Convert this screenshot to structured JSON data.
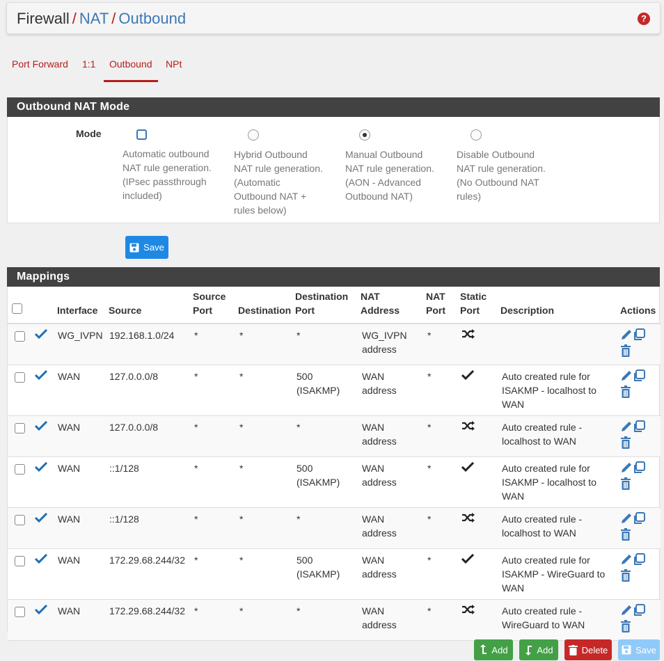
{
  "breadcrumb": {
    "part1": "Firewall",
    "sep1": "/",
    "part2": "NAT",
    "sep2": "/",
    "part3": "Outbound",
    "help_icon": "question-circle-icon"
  },
  "tabs": [
    {
      "label": "Port Forward",
      "active": false
    },
    {
      "label": "1:1",
      "active": false
    },
    {
      "label": "Outbound",
      "active": true
    },
    {
      "label": "NPt",
      "active": false
    }
  ],
  "mode_panel": {
    "title": "Outbound NAT Mode",
    "label": "Mode",
    "options": [
      {
        "text": [
          "Automatic outbound",
          "NAT rule generation.",
          "(IPsec passthrough",
          "included)"
        ],
        "selected": false
      },
      {
        "text": [
          "Hybrid Outbound",
          "NAT rule generation.",
          "(Automatic",
          "Outbound NAT +",
          "rules below)"
        ],
        "selected": false
      },
      {
        "text": [
          "Manual Outbound",
          "NAT rule generation.",
          "(AON - Advanced",
          "Outbound NAT)"
        ],
        "selected": true
      },
      {
        "text": [
          "Disable Outbound",
          "NAT rule generation.",
          "(No Outbound NAT",
          "rules)"
        ],
        "selected": false
      }
    ],
    "save_label": "Save"
  },
  "mappings": {
    "title": "Mappings",
    "headers": {
      "interface": "Interface",
      "source": "Source",
      "source_port": [
        "Source",
        "Port"
      ],
      "destination": "Destination",
      "destination_port": [
        "Destination",
        "Port"
      ],
      "nat_address": "NAT Address",
      "nat_port": [
        "NAT",
        "Port"
      ],
      "static_port": [
        "Static",
        "Port"
      ],
      "description": "Description",
      "actions": "Actions"
    },
    "rows": [
      {
        "interface": "WG_IVPN",
        "source": "192.168.1.0/24",
        "source_port": "*",
        "destination": "*",
        "destination_port": [
          "*"
        ],
        "nat_address": [
          "WG_IVPN",
          "address"
        ],
        "nat_port": "*",
        "static": "shuffle",
        "description": []
      },
      {
        "interface": "WAN",
        "source": "127.0.0.0/8",
        "source_port": "*",
        "destination": "*",
        "destination_port": [
          "500",
          "(ISAKMP)"
        ],
        "nat_address": [
          "WAN",
          "address"
        ],
        "nat_port": "*",
        "static": "check",
        "description": [
          "Auto created rule for",
          "ISAKMP - localhost to",
          "WAN"
        ]
      },
      {
        "interface": "WAN",
        "source": "127.0.0.0/8",
        "source_port": "*",
        "destination": "*",
        "destination_port": [
          "*"
        ],
        "nat_address": [
          "WAN",
          "address"
        ],
        "nat_port": "*",
        "static": "shuffle",
        "description": [
          "Auto created rule -",
          "localhost to WAN"
        ]
      },
      {
        "interface": "WAN",
        "source": "::1/128",
        "source_port": "*",
        "destination": "*",
        "destination_port": [
          "500",
          "(ISAKMP)"
        ],
        "nat_address": [
          "WAN",
          "address"
        ],
        "nat_port": "*",
        "static": "check",
        "description": [
          "Auto created rule for",
          "ISAKMP - localhost to",
          "WAN"
        ]
      },
      {
        "interface": "WAN",
        "source": "::1/128",
        "source_port": "*",
        "destination": "*",
        "destination_port": [
          "*"
        ],
        "nat_address": [
          "WAN",
          "address"
        ],
        "nat_port": "*",
        "static": "shuffle",
        "description": [
          "Auto created rule -",
          "localhost to WAN"
        ]
      },
      {
        "interface": "WAN",
        "source": "172.29.68.244/32",
        "source_port": "*",
        "destination": "*",
        "destination_port": [
          "500",
          "(ISAKMP)"
        ],
        "nat_address": [
          "WAN",
          "address"
        ],
        "nat_port": "*",
        "static": "check",
        "description": [
          "Auto created rule for",
          "ISAKMP - WireGuard to",
          "WAN"
        ]
      },
      {
        "interface": "WAN",
        "source": "172.29.68.244/32",
        "source_port": "*",
        "destination": "*",
        "destination_port": [
          "*"
        ],
        "nat_address": [
          "WAN",
          "address"
        ],
        "nat_port": "*",
        "static": "shuffle",
        "description": [
          "Auto created rule -",
          "WireGuard to WAN"
        ]
      }
    ]
  },
  "footer_buttons": {
    "add_top": "Add",
    "add_bottom": "Add",
    "delete": "Delete",
    "save": "Save"
  },
  "colors": {
    "accent_red": "#b71c1c",
    "link_blue": "#3c78b5",
    "panel_header": "#424242",
    "enabled_check": "#1e6fb5"
  }
}
